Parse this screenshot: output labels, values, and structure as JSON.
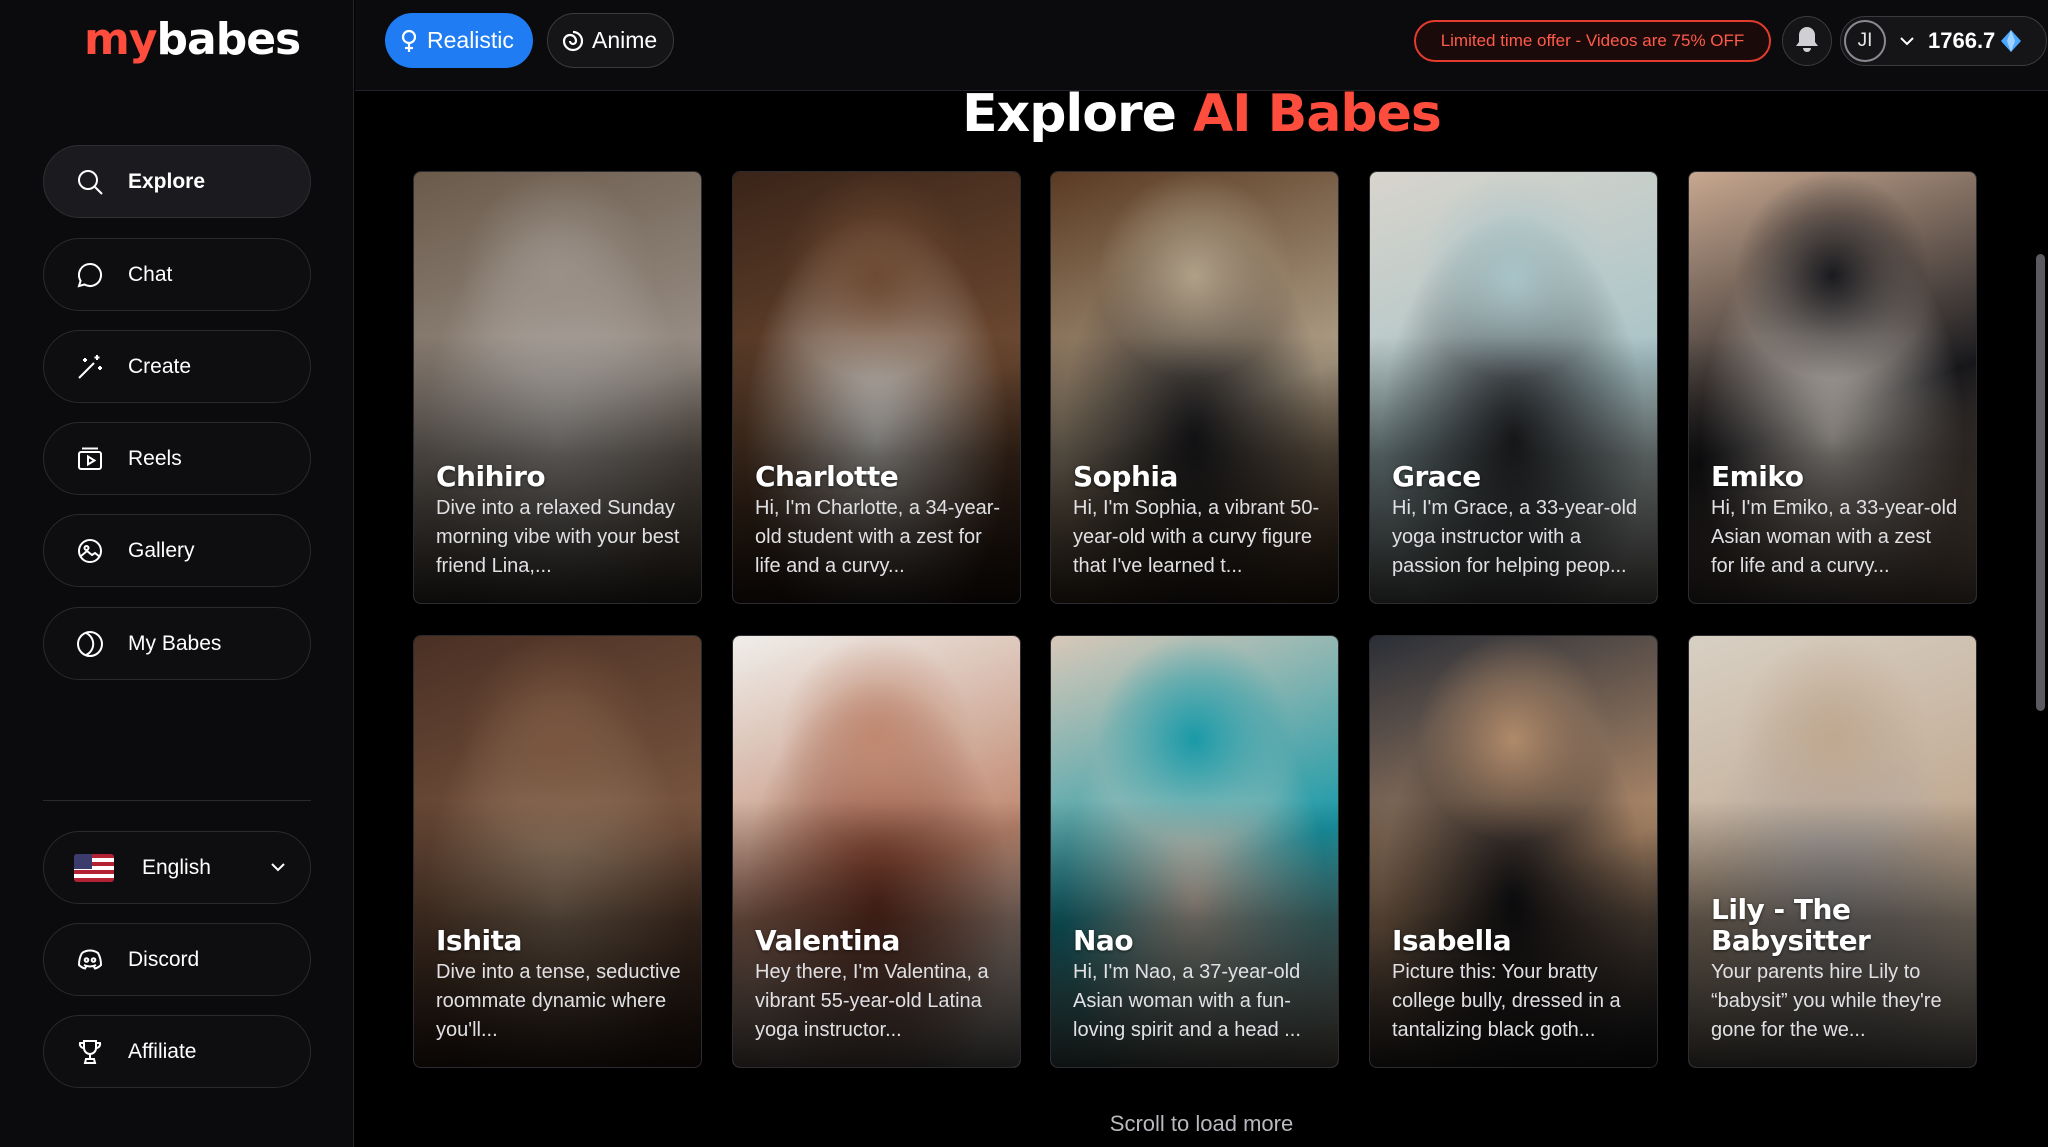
{
  "brand": {
    "part1": "my",
    "part2": "babes"
  },
  "sidebar": {
    "nav": [
      {
        "label": "Explore",
        "icon": "search-icon"
      },
      {
        "label": "Chat",
        "icon": "chat-bubble-icon"
      },
      {
        "label": "Create",
        "icon": "magic-wand-icon"
      },
      {
        "label": "Reels",
        "icon": "video-icon"
      },
      {
        "label": "Gallery",
        "icon": "gallery-icon"
      },
      {
        "label": "My Babes",
        "icon": "my-babes-icon"
      }
    ],
    "language": {
      "label": "English",
      "icon": "us-flag-icon"
    },
    "discord": {
      "label": "Discord",
      "icon": "discord-icon"
    },
    "affiliate": {
      "label": "Affiliate",
      "icon": "trophy-icon"
    }
  },
  "topbar": {
    "style_tabs": [
      {
        "label": "Realistic",
        "icon": "female-icon",
        "active": true
      },
      {
        "label": "Anime",
        "icon": "swirl-icon",
        "active": false
      }
    ],
    "offer": "Limited time offer - Videos are 75% OFF",
    "avatar_initials": "JI",
    "credits": "1766.7"
  },
  "main": {
    "heading_white": "Explore",
    "heading_red": "AI Babes",
    "cards": [
      {
        "name": "Chihiro",
        "desc": "Dive into a relaxed Sunday morning vibe with your best friend Lina,...",
        "palette": [
          "#6a5a4a",
          "#9a9088",
          "#bdb8b4"
        ]
      },
      {
        "name": "Charlotte",
        "desc": "Hi, I'm Charlotte, a 34-year-old student with a zest for life and a curvy...",
        "palette": [
          "#3a2418",
          "#6e4a32",
          "#e8e6e2"
        ]
      },
      {
        "name": "Sophia",
        "desc": "Hi, I'm Sophia, a vibrant 50-year-old with a curvy figure that I've learned t...",
        "palette": [
          "#5a3a22",
          "#b0a088",
          "#202024"
        ]
      },
      {
        "name": "Grace",
        "desc": "Hi, I'm Grace, a 33-year-old yoga instructor with a passion for helping peop...",
        "palette": [
          "#d8d4cc",
          "#a8c4c8",
          "#2a2a2e"
        ]
      },
      {
        "name": "Emiko",
        "desc": "Hi, I'm Emiko, a 33-year-old Asian woman with a zest for life and a curvy...",
        "palette": [
          "#c8a890",
          "#1a1a1e",
          "#e8e0d8"
        ]
      },
      {
        "name": "Ishita",
        "desc": "Dive into a tense, seductive roommate dynamic where you'll...",
        "palette": [
          "#4a3024",
          "#7a5640",
          "#a0866e"
        ]
      },
      {
        "name": "Valentina",
        "desc": "Hey there, I'm Valentina, a vibrant 55-year-old Latina yoga instructor...",
        "palette": [
          "#f0eeea",
          "#c08870",
          "#7a3a28"
        ]
      },
      {
        "name": "Nao",
        "desc": "Hi, I'm Nao, a 37-year-old Asian woman with a fun-loving spirit and a head ...",
        "palette": [
          "#d8c8b8",
          "#1a9aa8",
          "#e8d8c8"
        ]
      },
      {
        "name": "Isabella",
        "desc": "Picture this: Your bratty college bully, dressed in a tantalizing black goth...",
        "palette": [
          "#2a2e36",
          "#b08a6a",
          "#141418"
        ]
      },
      {
        "name": "Lily - The Babysitter",
        "desc": "Your parents hire Lily to “babysit” you while they're gone for the we...",
        "palette": [
          "#d8d0c4",
          "#c0a890",
          "#a8a4a4"
        ]
      }
    ],
    "scroll_hint": "Scroll to load more"
  }
}
